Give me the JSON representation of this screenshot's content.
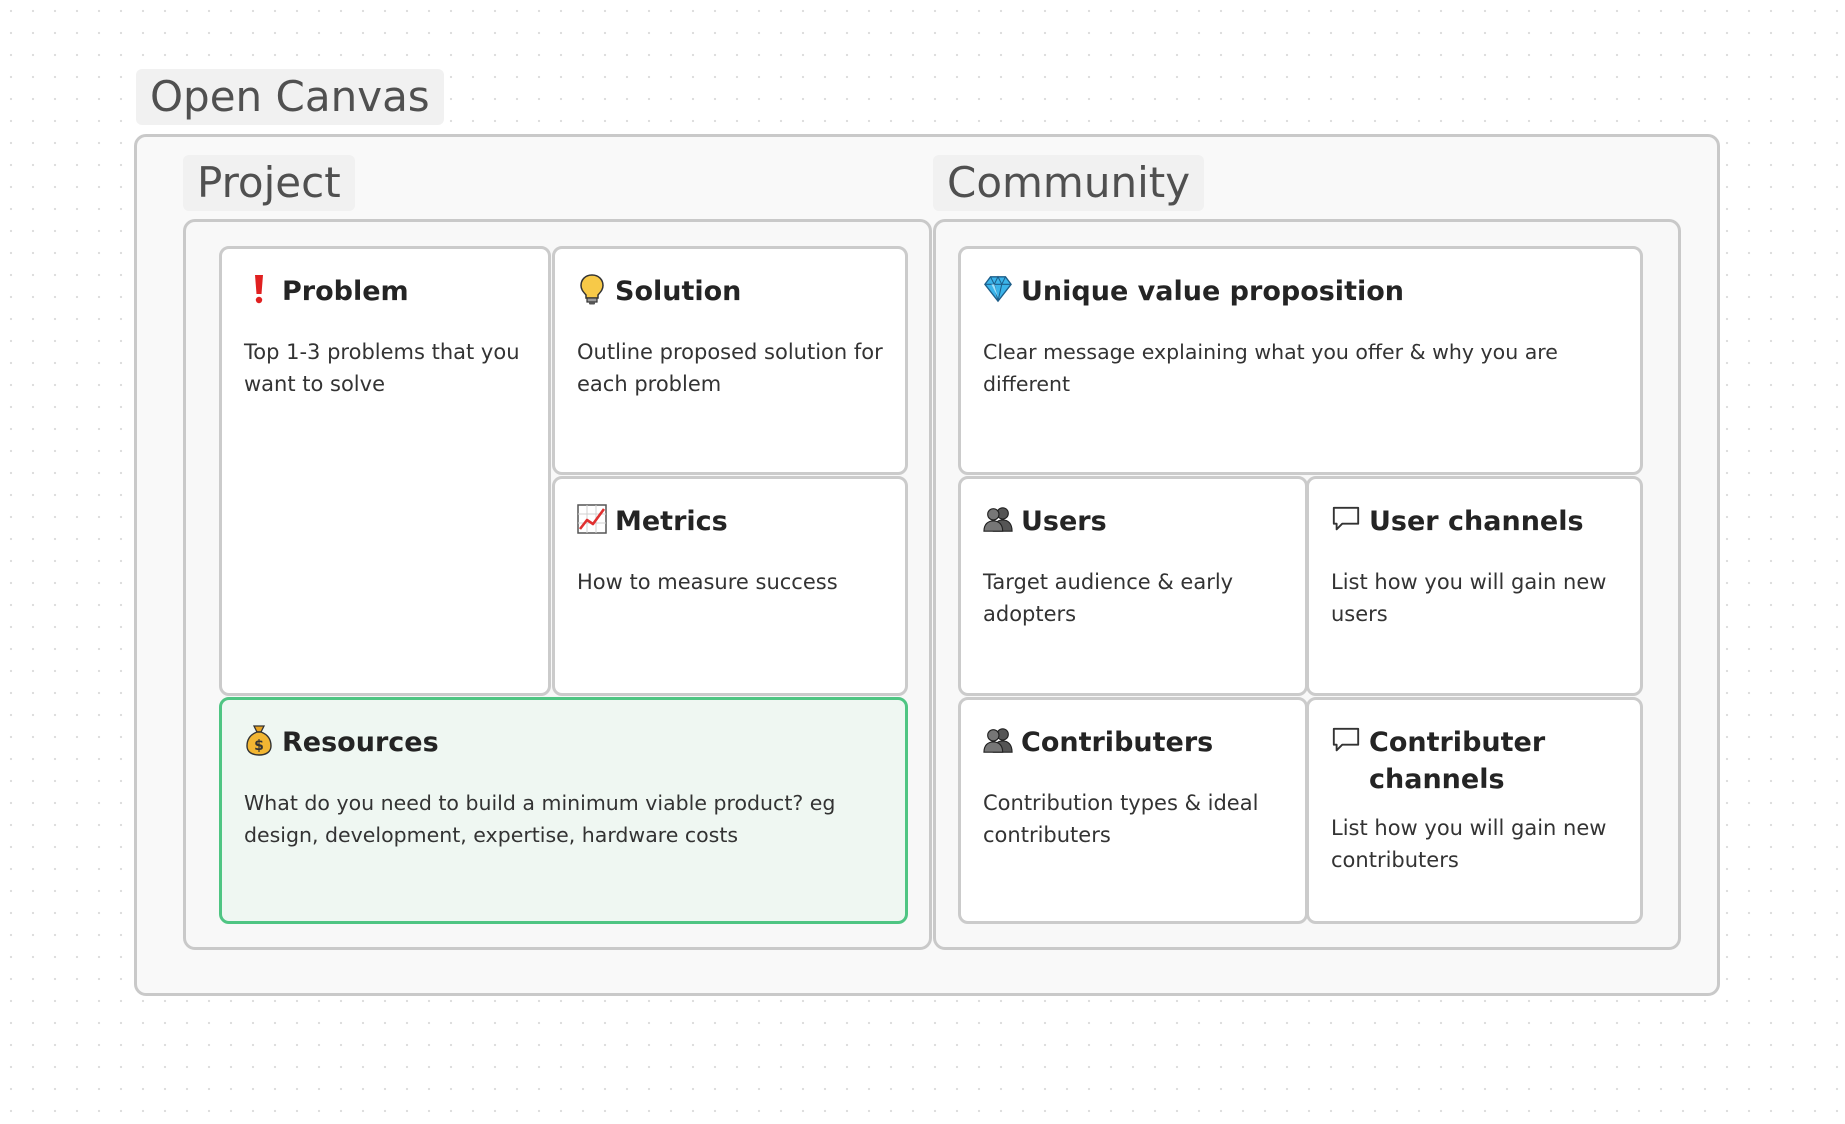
{
  "canvas": {
    "title": "Open Canvas",
    "project": {
      "title": "Project",
      "cards": {
        "problem": {
          "title": "Problem",
          "icon": "exclamation-icon",
          "description": "Top 1-3 problems that you want to solve"
        },
        "solution": {
          "title": "Solution",
          "icon": "lightbulb-icon",
          "description": "Outline proposed solution for each problem"
        },
        "metrics": {
          "title": "Metrics",
          "icon": "chart-increasing-icon",
          "description": "How to measure success"
        },
        "resources": {
          "title": "Resources",
          "icon": "money-bag-icon",
          "description": "What do you need to build a minimum viable product? eg design, development, expertise, hardware costs"
        }
      }
    },
    "community": {
      "title": "Community",
      "cards": {
        "uvp": {
          "title": "Unique value proposition",
          "icon": "gem-icon",
          "description": "Clear message explaining what you offer & why you are different"
        },
        "users": {
          "title": "Users",
          "icon": "people-icon",
          "description": "Target audience & early adopters"
        },
        "user_channels": {
          "title": "User channels",
          "icon": "speech-bubble-icon",
          "description": "List how you will gain new users"
        },
        "contributers": {
          "title": "Contributers",
          "icon": "people-icon",
          "description": "Contribution types & ideal contributers"
        },
        "contributer_channels": {
          "title": "Contributer channels",
          "icon": "speech-bubble-icon",
          "description": "List how you will gain new contributers"
        }
      }
    }
  },
  "colors": {
    "highlight_border": "#4fc583",
    "highlight_fill": "#eff7f2",
    "group_border": "#c9c9c9",
    "card_border": "#cbcbcb"
  }
}
